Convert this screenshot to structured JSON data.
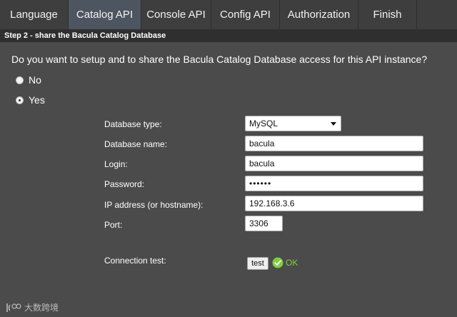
{
  "wizard": {
    "steps": [
      {
        "label": "Language"
      },
      {
        "label": "Catalog API"
      },
      {
        "label": "Console API"
      },
      {
        "label": "Config API"
      },
      {
        "label": "Authorization"
      },
      {
        "label": "Finish"
      },
      {
        "label": ""
      }
    ],
    "active_step": "Catalog API",
    "step_header": "Step 2 - share the Bacula Catalog Database"
  },
  "main": {
    "question": "Do you want to setup and to share the Bacula Catalog Database access for this API instance?",
    "options": [
      {
        "label": "No",
        "selected": false
      },
      {
        "label": "Yes",
        "selected": true
      }
    ]
  },
  "form": {
    "db_type": {
      "label": "Database type:",
      "value": "MySQL"
    },
    "db_name": {
      "label": "Database name:",
      "value": "bacula"
    },
    "login": {
      "label": "Login:",
      "value": "bacula"
    },
    "password": {
      "label": "Password:",
      "value": "••••••"
    },
    "ip": {
      "label": "IP address (or hostname):",
      "value": "192.168.3.6"
    },
    "port": {
      "label": "Port:",
      "value": "3306"
    },
    "connection_test": {
      "label": "Connection test:",
      "button": "test",
      "result": "OK"
    }
  },
  "watermark": {
    "text": "大数跨境"
  },
  "colors": {
    "background": "#4b4b4b",
    "tab_bar": "#3e3e3e",
    "active_tab": "#4c5560",
    "step_header": "#2f2f2f",
    "ok_green": "#7fcf3c"
  },
  "icons": [
    "check-circle-icon",
    "chevron-down-icon",
    "brand-logo-icon"
  ]
}
